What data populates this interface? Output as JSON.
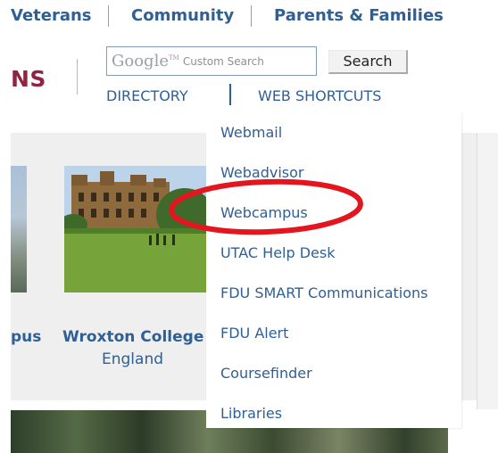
{
  "top_nav": {
    "items": [
      {
        "label": "Veterans"
      },
      {
        "label": "Community"
      },
      {
        "label": "Parents & Families"
      }
    ]
  },
  "brand": {
    "text": "NS"
  },
  "search": {
    "google_logo": "Google",
    "google_tm": "TM",
    "placeholder": "Custom Search",
    "button_label": "Search"
  },
  "sublinks": {
    "directory": "DIRECTORY",
    "web_shortcuts": "WEB SHORTCUTS"
  },
  "carousel": {
    "left_caption": "pus",
    "wroxton_title": "Wroxton College",
    "wroxton_subtitle": "England"
  },
  "dropdown": {
    "items": [
      {
        "label": "Webmail"
      },
      {
        "label": "Webadvisor"
      },
      {
        "label": "Webcampus"
      },
      {
        "label": "UTAC Help Desk"
      },
      {
        "label": "FDU SMART Communications"
      },
      {
        "label": "FDU Alert"
      },
      {
        "label": "Coursefinder"
      },
      {
        "label": "Libraries"
      }
    ]
  },
  "annotation": {
    "color": "#e3161f"
  }
}
